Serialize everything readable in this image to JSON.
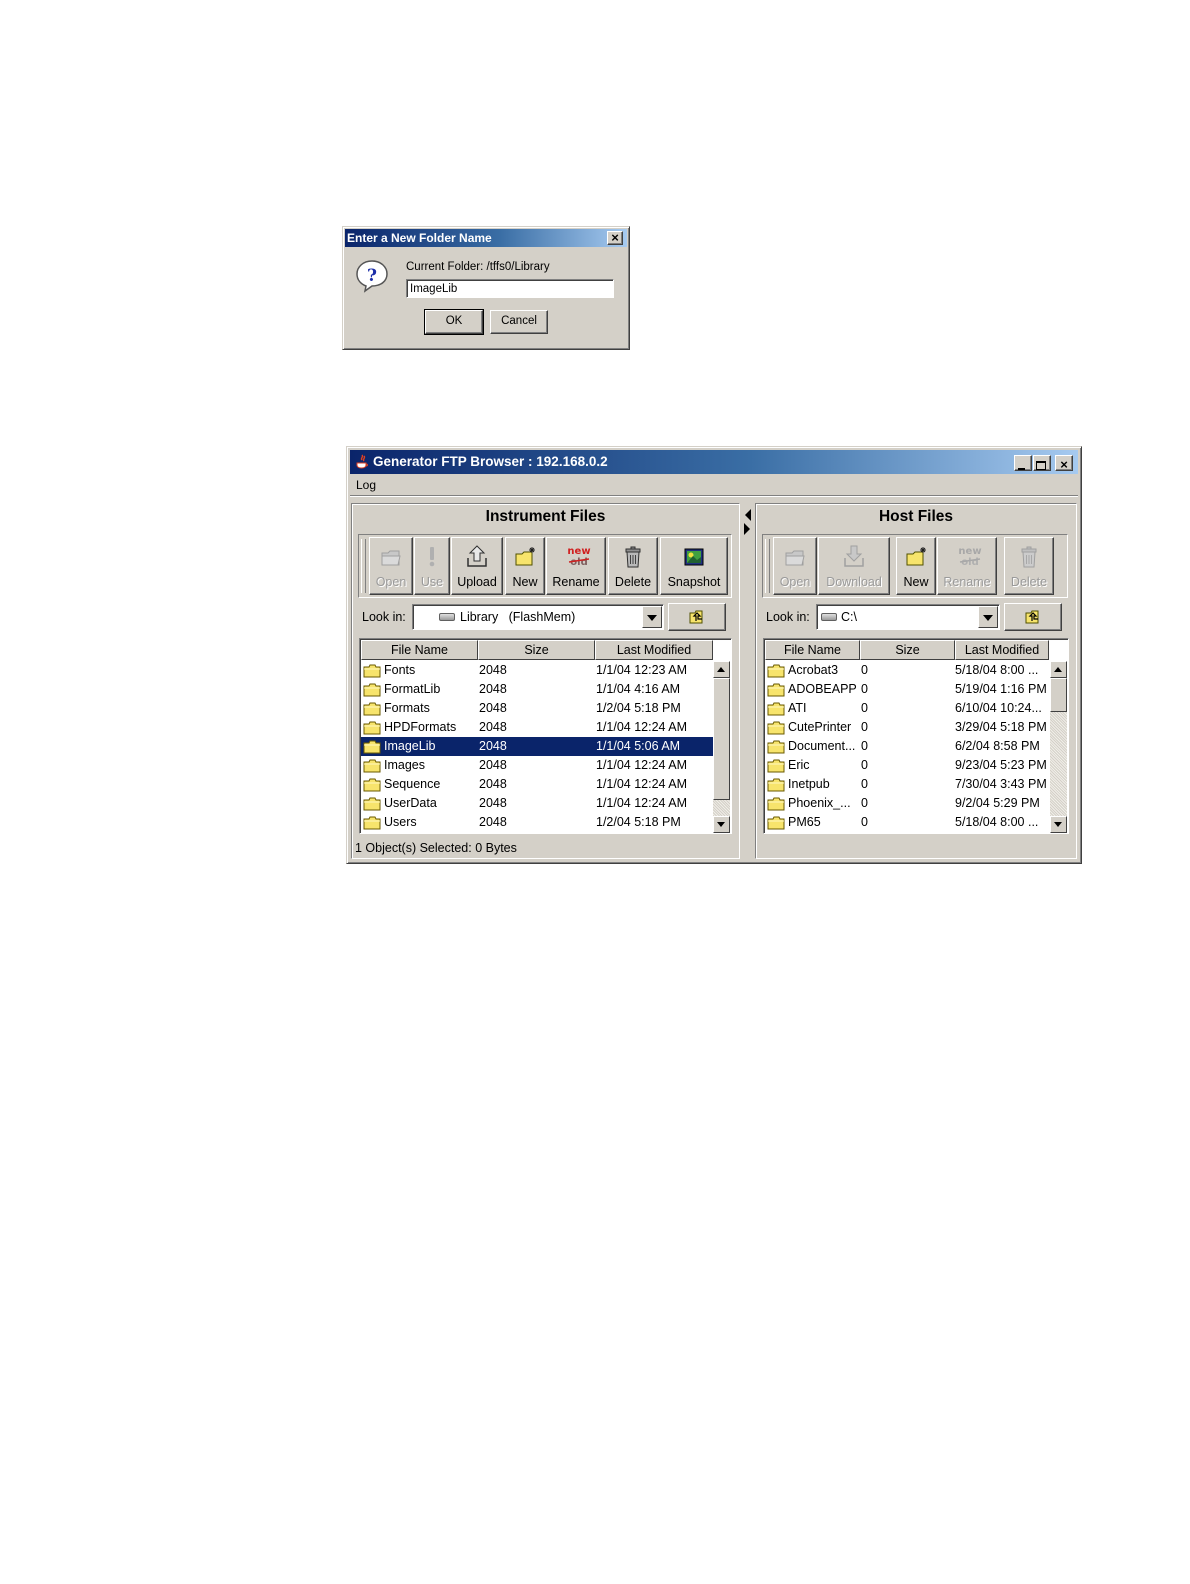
{
  "dialog": {
    "title": "Enter a New Folder Name",
    "label": "Current Folder: /tffs0/Library",
    "input_value": "ImageLib",
    "ok_label": "OK",
    "cancel_label": "Cancel"
  },
  "window": {
    "title": "Generator FTP Browser : 192.168.0.2",
    "menu": {
      "log": "Log"
    },
    "left": {
      "title": "Instrument Files",
      "toolbar": {
        "open": "Open",
        "use": "Use",
        "upload": "Upload",
        "new": "New",
        "rename": "Rename",
        "delete": "Delete",
        "snapshot": "Snapshot"
      },
      "look_in_label": "Look in:",
      "look_in_value": "Library   (FlashMem)",
      "columns": [
        "File Name",
        "Size",
        "Last Modified"
      ],
      "rows": [
        {
          "name": "Fonts",
          "size": "2048",
          "modified": "1/1/04 12:23 AM"
        },
        {
          "name": "FormatLib",
          "size": "2048",
          "modified": "1/1/04 4:16 AM"
        },
        {
          "name": "Formats",
          "size": "2048",
          "modified": "1/2/04 5:18 PM"
        },
        {
          "name": "HPDFormats",
          "size": "2048",
          "modified": "1/1/04 12:24 AM"
        },
        {
          "name": "ImageLib",
          "size": "2048",
          "modified": "1/1/04 5:06 AM"
        },
        {
          "name": "Images",
          "size": "2048",
          "modified": "1/1/04 12:24 AM"
        },
        {
          "name": "Sequence",
          "size": "2048",
          "modified": "1/1/04 12:24 AM"
        },
        {
          "name": "UserData",
          "size": "2048",
          "modified": "1/1/04 12:24 AM"
        },
        {
          "name": "Users",
          "size": "2048",
          "modified": "1/2/04 5:18 PM"
        }
      ],
      "selected_row": "ImageLib",
      "status": "1 Object(s) Selected:  0 Bytes"
    },
    "right": {
      "title": "Host Files",
      "toolbar": {
        "open": "Open",
        "download": "Download",
        "new": "New",
        "rename": "Rename",
        "delete": "Delete"
      },
      "look_in_label": "Look in:",
      "look_in_value": "C:\\",
      "columns": [
        "File Name",
        "Size",
        "Last Modified"
      ],
      "rows": [
        {
          "name": "Acrobat3",
          "size": "0",
          "modified": "5/18/04 8:00 ..."
        },
        {
          "name": "ADOBEAPP",
          "size": "0",
          "modified": "5/19/04 1:16 PM"
        },
        {
          "name": "ATI",
          "size": "0",
          "modified": "6/10/04 10:24..."
        },
        {
          "name": "CutePrinter",
          "size": "0",
          "modified": "3/29/04 5:18 PM"
        },
        {
          "name": "Document...",
          "size": "0",
          "modified": "6/2/04 8:58 PM"
        },
        {
          "name": "Eric",
          "size": "0",
          "modified": "9/23/04 5:23 PM"
        },
        {
          "name": "Inetpub",
          "size": "0",
          "modified": "7/30/04 3:43 PM"
        },
        {
          "name": "Phoenix_...",
          "size": "0",
          "modified": "9/2/04 5:29 PM"
        },
        {
          "name": "PM65",
          "size": "0",
          "modified": "5/18/04 8:00 ..."
        }
      ]
    }
  },
  "colors": {
    "selection": "#0a246a",
    "title_start": "#0a246a",
    "title_end": "#a6caf0",
    "face": "#d4d0c8",
    "folder": "#f7e46c"
  }
}
